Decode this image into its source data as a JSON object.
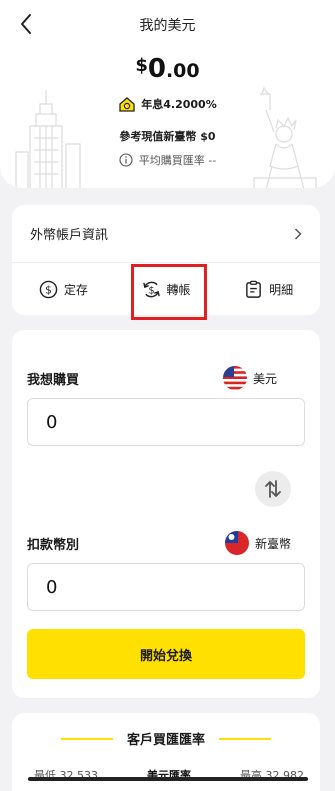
{
  "header": {
    "title": "我的美元",
    "balance_currency": "$",
    "balance_int": "0",
    "balance_dec": ".00",
    "interest": "年息4.2000%",
    "reference": "參考現值新臺幣 $0",
    "avg_rate": "平均購買匯率 --"
  },
  "account": {
    "info_label": "外幣帳戶資訊",
    "actions": [
      {
        "label": "定存",
        "icon": "dollar-circle-icon"
      },
      {
        "label": "轉帳",
        "icon": "transfer-icon"
      },
      {
        "label": "明細",
        "icon": "statement-icon"
      }
    ]
  },
  "exchange": {
    "buy_label": "我想購買",
    "buy_currency": "美元",
    "buy_value": "0",
    "debit_label": "扣款幣別",
    "debit_currency": "新臺幣",
    "debit_value": "0",
    "submit_label": "開始兌換"
  },
  "rates": {
    "title": "客戶買匯匯率",
    "low": "最低 32.533",
    "mid_label": "美元匯率",
    "high": "最高 32.982"
  },
  "colors": {
    "accent": "#ffe000",
    "highlight": "#e02020",
    "background": "#f2f2f4"
  }
}
